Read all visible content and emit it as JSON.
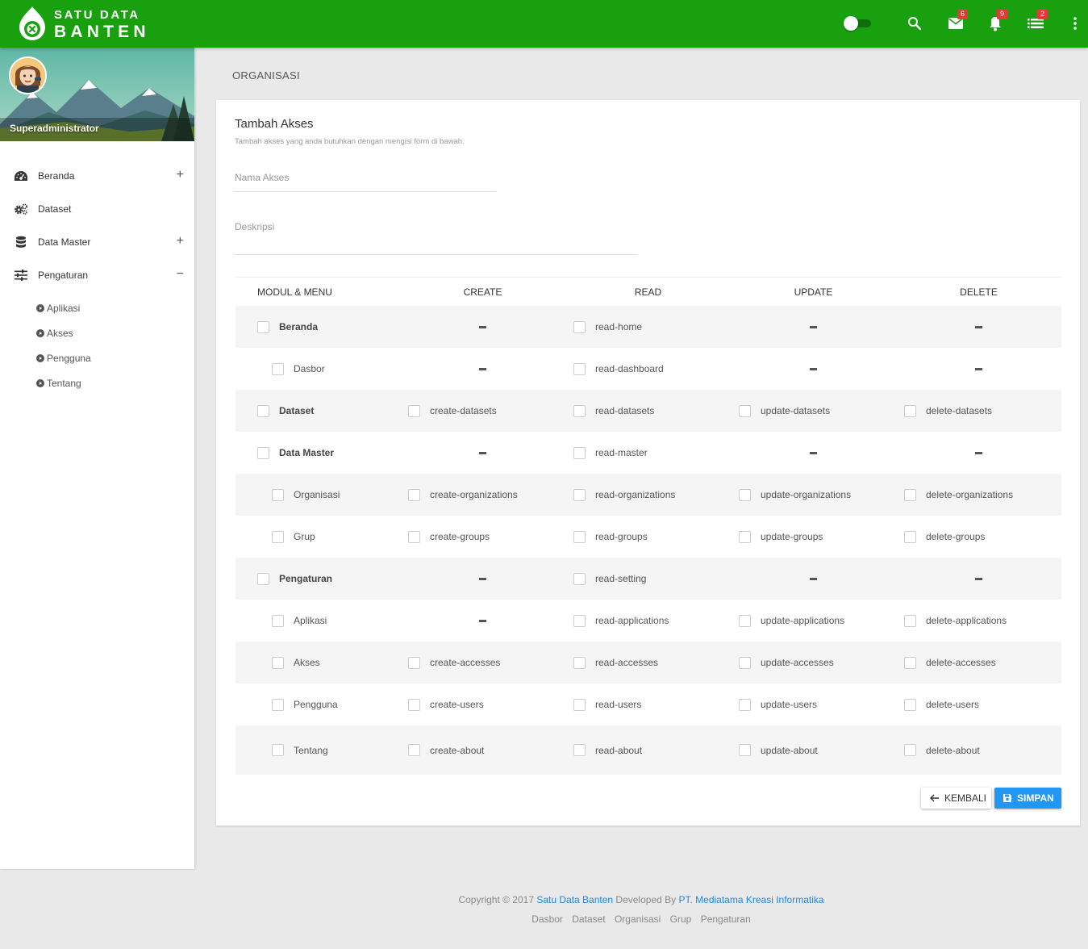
{
  "brand": {
    "line1": "SATU DATA",
    "line2": "BANTEN",
    "color": "#18a00f"
  },
  "topbar": {
    "icons": [
      "toggle-switch",
      "search-icon",
      "mail-icon",
      "bell-icon",
      "list-icon",
      "more-vert-icon"
    ],
    "mail_count": "6",
    "notif_count": "9",
    "task_count": "2"
  },
  "profile": {
    "name": "Superadministrator"
  },
  "sidebar": {
    "items": [
      {
        "label": "Beranda",
        "icon": "dashboard-icon",
        "sign": "+"
      },
      {
        "label": "Dataset",
        "icon": "gears-icon",
        "sign": ""
      },
      {
        "label": "Data Master",
        "icon": "database-icon",
        "sign": "+"
      },
      {
        "label": "Pengaturan",
        "icon": "sliders-icon",
        "sign": "−"
      }
    ],
    "subitems": [
      "Aplikasi",
      "Akses",
      "Pengguna",
      "Tentang"
    ]
  },
  "page": {
    "title": "ORGANISASI"
  },
  "form": {
    "title": "Tambah Akses",
    "subtitle": "Tambah akses yang anda butuhkan dengan mengisi form di bawah.",
    "name_placeholder": "Nama Akses",
    "desc_placeholder": "Deskripsi",
    "headers": [
      "MODUL & MENU",
      "CREATE",
      "READ",
      "UPDATE",
      "DELETE"
    ],
    "back_label": "KEMBALI",
    "save_label": "SIMPAN",
    "save_color": "#2196f3"
  },
  "permissions": [
    {
      "menu": "Beranda",
      "level": "parent",
      "create": "",
      "read": "read-home",
      "update": "",
      "delete": ""
    },
    {
      "menu": "Dasbor",
      "level": "child",
      "create": "",
      "read": "read-dashboard",
      "update": "",
      "delete": ""
    },
    {
      "menu": "Dataset",
      "level": "parent",
      "create": "create-datasets",
      "read": "read-datasets",
      "update": "update-datasets",
      "delete": "delete-datasets"
    },
    {
      "menu": "Data Master",
      "level": "parent",
      "create": "",
      "read": "read-master",
      "update": "",
      "delete": ""
    },
    {
      "menu": "Organisasi",
      "level": "child",
      "create": "create-organizations",
      "read": "read-organizations",
      "update": "update-organizations",
      "delete": "delete-organizations"
    },
    {
      "menu": "Grup",
      "level": "child",
      "create": "create-groups",
      "read": "read-groups",
      "update": "update-groups",
      "delete": "delete-groups"
    },
    {
      "menu": "Pengaturan",
      "level": "parent",
      "create": "",
      "read": "read-setting",
      "update": "",
      "delete": ""
    },
    {
      "menu": "Aplikasi",
      "level": "child",
      "create": "",
      "read": "read-applications",
      "update": "update-applications",
      "delete": "delete-applications"
    },
    {
      "menu": "Akses",
      "level": "child",
      "create": "create-accesses",
      "read": "read-accesses",
      "update": "update-accesses",
      "delete": "delete-accesses"
    },
    {
      "menu": "Pengguna",
      "level": "child",
      "create": "create-users",
      "read": "read-users",
      "update": "update-users",
      "delete": "delete-users"
    },
    {
      "menu": "Tentang",
      "level": "child",
      "create": "create-about",
      "read": "read-about",
      "update": "update-about",
      "delete": "delete-about"
    }
  ],
  "footer": {
    "copyright_prefix": "Copyright © 2017",
    "site_name": "Satu Data Banten",
    "developed_by": "Developed By",
    "company": "PT. Mediatama Kreasi Informatika",
    "links": [
      "Dasbor",
      "Dataset",
      "Organisasi",
      "Grup",
      "Pengaturan"
    ]
  }
}
